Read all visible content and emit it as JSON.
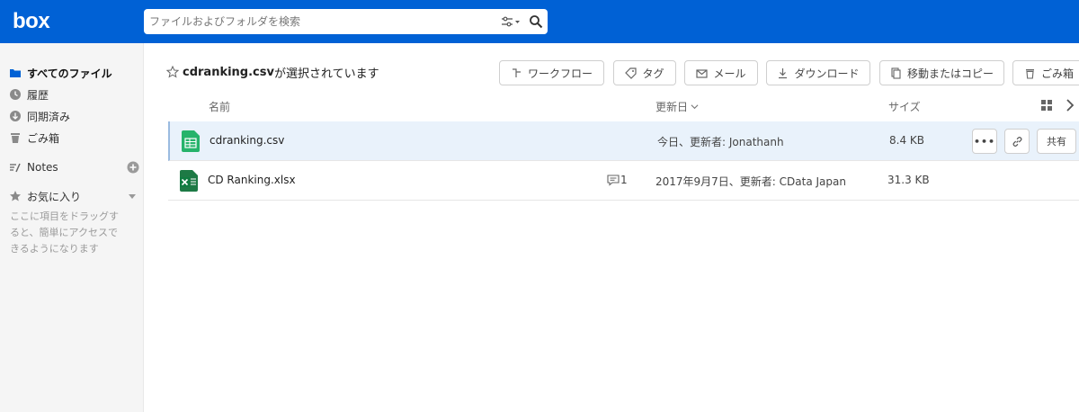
{
  "header": {
    "logo": "box",
    "search_placeholder": "ファイルおよびフォルダを検索"
  },
  "sidebar": {
    "items": [
      {
        "label": "すべてのファイル",
        "icon": "folder-icon"
      },
      {
        "label": "履歴",
        "icon": "clock-icon"
      },
      {
        "label": "同期済み",
        "icon": "sync-icon"
      },
      {
        "label": "ごみ箱",
        "icon": "trash-icon"
      }
    ],
    "notes_label": "Notes",
    "favorites_label": "お気に入り",
    "favorites_hint": "ここに項目をドラッグすると、簡単にアクセスできるようになります"
  },
  "main": {
    "selection_file": "cdranking.csv",
    "selection_suffix": "が選択されています",
    "toolbar": {
      "workflow": "ワークフロー",
      "tag": "タグ",
      "mail": "メール",
      "download": "ダウンロード",
      "move_copy": "移動またはコピー",
      "trash": "ごみ箱"
    },
    "columns": {
      "name": "名前",
      "updated": "更新日",
      "size": "サイズ"
    },
    "files": [
      {
        "name": "cdranking.csv",
        "updated": "今日、更新者: Jonathanh",
        "size": "8.4 KB",
        "icon": "csv-file-icon",
        "selected": true
      },
      {
        "name": "CD Ranking.xlsx",
        "updated": "2017年9月7日、更新者: CData Japan",
        "size": "31.3 KB",
        "icon": "xlsx-file-icon",
        "comments": "1"
      }
    ],
    "row_actions": {
      "more": "•••",
      "share": "共有"
    }
  },
  "colors": {
    "brand": "#0061d5",
    "sidebar_bg": "#f5f5f5",
    "selected_row": "#e9f2fb"
  }
}
